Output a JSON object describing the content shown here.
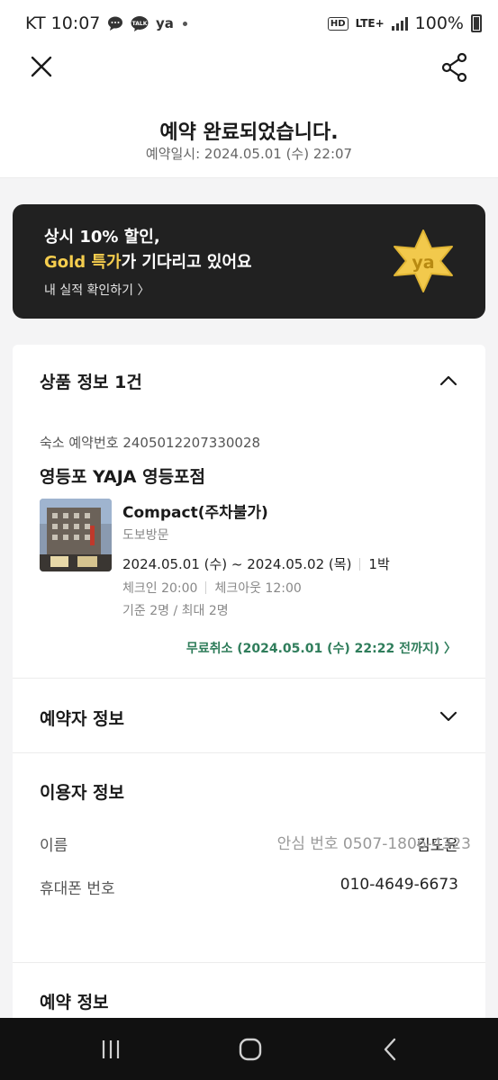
{
  "status_bar": {
    "carrier_time": "KT 10:07",
    "icons": [
      "chat-bubble-icon",
      "kakaotalk-icon",
      "yanolja-icon",
      "notification-dot-icon"
    ],
    "hd_badge": "HD",
    "network": "LTE+",
    "battery": "100%"
  },
  "header": {
    "title": "예약 완료되었습니다.",
    "subtitle": "예약일시: 2024.05.01 (수) 22:07",
    "close_icon": "close-icon",
    "share_icon": "share-icon"
  },
  "promo_banner": {
    "line1": "상시 10% 할인,",
    "line2_highlight": "Gold 특가",
    "line2_rest": "가 기다리고 있어요",
    "link": "내 실적 확인하기 〉",
    "star_text": "ya",
    "colors": {
      "background": "#212121",
      "gold": "#f5cd4e"
    }
  },
  "product_section": {
    "title": "상품 정보 1건",
    "booking_number": "숙소 예약번호 2405012207330028",
    "hotel_name": "영등포 YAJA 영등포점",
    "room_name": "Compact(주차불가)",
    "visit_type": "도보방문",
    "check_in_date": "2024.05.01 (수) ~ 2024.05.02 (목)",
    "nights": "1박",
    "check_in_time": "체크인 20:00",
    "check_out_time": "체크아웃 12:00",
    "capacity": "기준 2명 / 최대 2명",
    "free_cancel": "무료취소 (2024.05.01 (수) 22:22 전까지) 〉",
    "colors": {
      "free_cancel": "#2f7d5b"
    }
  },
  "booker_section": {
    "title": "예약자 정보"
  },
  "user_section": {
    "title": "이용자 정보",
    "name_label": "이름",
    "name_value": "김도윤",
    "phone_label": "휴대폰 번호",
    "phone_value": "010-4649-6673",
    "safe_number": "안심 번호 0507-1806-4323"
  },
  "reservation_section": {
    "title": "예약 정보"
  },
  "nav_bar": {
    "icons": [
      "recent-apps-icon",
      "home-icon",
      "back-icon"
    ]
  }
}
